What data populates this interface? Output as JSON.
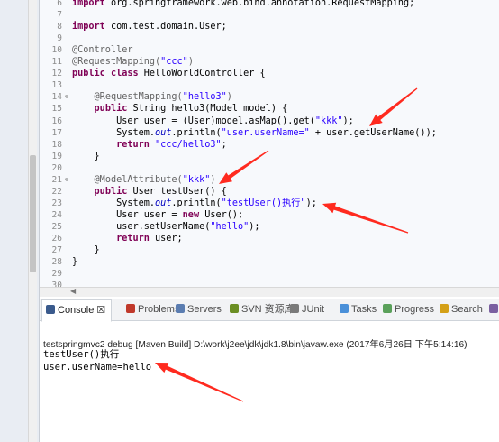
{
  "editor": {
    "lines": [
      {
        "no": "6",
        "fold": "",
        "parts": [
          {
            "t": "import",
            "c": "kw"
          },
          {
            "t": " org.springframework.web.bind.annotation.RequestMapping;"
          }
        ]
      },
      {
        "no": "7",
        "fold": "",
        "parts": []
      },
      {
        "no": "8",
        "fold": "",
        "parts": [
          {
            "t": "import",
            "c": "kw"
          },
          {
            "t": " com.test.domain.User;"
          }
        ]
      },
      {
        "no": "9",
        "fold": "",
        "parts": []
      },
      {
        "no": "10",
        "fold": "",
        "parts": [
          {
            "t": "@Controller",
            "c": "ann"
          }
        ]
      },
      {
        "no": "11",
        "fold": "",
        "parts": [
          {
            "t": "@RequestMapping(",
            "c": "ann"
          },
          {
            "t": "\"ccc\"",
            "c": "str"
          },
          {
            "t": ")",
            "c": "ann"
          }
        ]
      },
      {
        "no": "12",
        "fold": "",
        "parts": [
          {
            "t": "public",
            "c": "kw"
          },
          {
            "t": " "
          },
          {
            "t": "class",
            "c": "kw"
          },
          {
            "t": " HelloWorldController {"
          }
        ]
      },
      {
        "no": "13",
        "fold": "",
        "parts": []
      },
      {
        "no": "14",
        "fold": "⊖",
        "parts": [
          {
            "t": "    "
          },
          {
            "t": "@RequestMapping(",
            "c": "ann"
          },
          {
            "t": "\"hello3\"",
            "c": "str"
          },
          {
            "t": ")",
            "c": "ann"
          }
        ]
      },
      {
        "no": "15",
        "fold": "",
        "parts": [
          {
            "t": "    "
          },
          {
            "t": "public",
            "c": "kw"
          },
          {
            "t": " String hello3(Model model) {"
          }
        ]
      },
      {
        "no": "16",
        "fold": "",
        "parts": [
          {
            "t": "        User user = (User)model.asMap().get("
          },
          {
            "t": "\"kkk\"",
            "c": "str"
          },
          {
            "t": ");"
          }
        ]
      },
      {
        "no": "17",
        "fold": "",
        "parts": [
          {
            "t": "        System."
          },
          {
            "t": "out",
            "c": "fld"
          },
          {
            "t": ".println("
          },
          {
            "t": "\"user.userName=\"",
            "c": "str"
          },
          {
            "t": " + user.getUserName());"
          }
        ]
      },
      {
        "no": "18",
        "fold": "",
        "parts": [
          {
            "t": "        "
          },
          {
            "t": "return",
            "c": "kw"
          },
          {
            "t": " "
          },
          {
            "t": "\"ccc/hello3\"",
            "c": "str"
          },
          {
            "t": ";"
          }
        ]
      },
      {
        "no": "19",
        "fold": "",
        "parts": [
          {
            "t": "    }"
          }
        ]
      },
      {
        "no": "20",
        "fold": "",
        "parts": []
      },
      {
        "no": "21",
        "fold": "⊖",
        "parts": [
          {
            "t": "    "
          },
          {
            "t": "@ModelAttribute(",
            "c": "ann"
          },
          {
            "t": "\"kkk\"",
            "c": "str"
          },
          {
            "t": ")",
            "c": "ann"
          }
        ]
      },
      {
        "no": "22",
        "fold": "",
        "parts": [
          {
            "t": "    "
          },
          {
            "t": "public",
            "c": "kw"
          },
          {
            "t": " User testUser() {"
          }
        ]
      },
      {
        "no": "23",
        "fold": "",
        "parts": [
          {
            "t": "        System."
          },
          {
            "t": "out",
            "c": "fld"
          },
          {
            "t": ".println("
          },
          {
            "t": "\"testUser()执行\"",
            "c": "str"
          },
          {
            "t": ");"
          }
        ]
      },
      {
        "no": "24",
        "fold": "",
        "parts": [
          {
            "t": "        User user = "
          },
          {
            "t": "new",
            "c": "kw"
          },
          {
            "t": " User();"
          }
        ]
      },
      {
        "no": "25",
        "fold": "",
        "parts": [
          {
            "t": "        user.setUserName("
          },
          {
            "t": "\"hello\"",
            "c": "str"
          },
          {
            "t": ");"
          }
        ]
      },
      {
        "no": "26",
        "fold": "",
        "parts": [
          {
            "t": "        "
          },
          {
            "t": "return",
            "c": "kw"
          },
          {
            "t": " user;"
          }
        ]
      },
      {
        "no": "27",
        "fold": "",
        "parts": [
          {
            "t": "    }"
          }
        ]
      },
      {
        "no": "28",
        "fold": "",
        "parts": [
          {
            "t": "}"
          }
        ]
      },
      {
        "no": "29",
        "fold": "",
        "parts": []
      },
      {
        "no": "30",
        "fold": "",
        "parts": []
      }
    ]
  },
  "views": {
    "tabs": [
      {
        "label": "Console ☒",
        "icon": "console-icon",
        "active": true
      },
      {
        "label": "Problems",
        "icon": "problems-icon"
      },
      {
        "label": "Servers",
        "icon": "servers-icon"
      },
      {
        "label": "SVN 资源库",
        "icon": "svn-icon"
      },
      {
        "label": "JUnit",
        "icon": "junit-icon"
      },
      {
        "label": "Tasks",
        "icon": "tasks-icon"
      },
      {
        "label": "Progress",
        "icon": "progress-icon"
      },
      {
        "label": "Search",
        "icon": "search-icon"
      },
      {
        "label": "Syn",
        "icon": "synchronize-icon"
      }
    ]
  },
  "console": {
    "description": "testspringmvc2 debug [Maven Build] D:\\work\\j2ee\\jdk\\jdk1.8\\bin\\javaw.exe (2017年6月26日 下午5:14:16)",
    "output": [
      "testUser()执行",
      "user.userName=hello"
    ]
  },
  "colors": {
    "arrow": "#ff2a1f",
    "keyword": "#7f0055",
    "string": "#2a00ff",
    "annotation": "#646464"
  }
}
